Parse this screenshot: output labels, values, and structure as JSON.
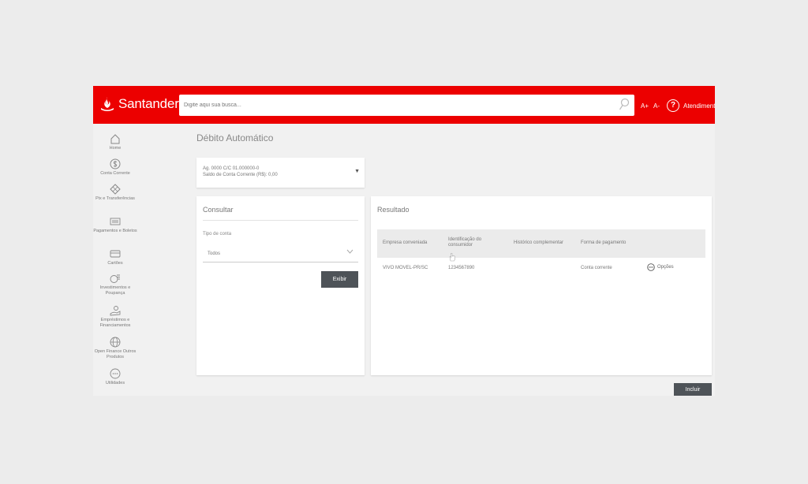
{
  "header": {
    "brand": "Santander",
    "search_placeholder": "Digite aqui sua busca...",
    "font_increase": "A+",
    "font_decrease": "A-",
    "help_label": "Atendimento"
  },
  "sidebar": {
    "items": [
      {
        "label": "Home",
        "icon": "home-icon"
      },
      {
        "label": "Conta Corrente",
        "icon": "dollar-icon"
      },
      {
        "label": "Pix e Transferências",
        "icon": "pix-icon"
      },
      {
        "label": "Pagamentos e Boletos",
        "icon": "barcode-icon"
      },
      {
        "label": "Cartões",
        "icon": "card-icon"
      },
      {
        "label": "Investimentos e Poupança",
        "icon": "investment-icon"
      },
      {
        "label": "Empréstimos e Financiamentos",
        "icon": "loan-icon"
      },
      {
        "label": "Open Finance Outros Produtos",
        "icon": "globe-icon"
      },
      {
        "label": "Utilidades",
        "icon": "more-icon"
      }
    ]
  },
  "main": {
    "title": "Débito Automático",
    "account": {
      "line1": "Ag. 0000 C/C 01.000000-0",
      "line2": "Saldo de Conta Corrente (R$): 0,00"
    },
    "consultar": {
      "title": "Consultar",
      "conta_label": "Tipo de conta",
      "select_value": "Todos",
      "button": "Exibir"
    },
    "resultado": {
      "title": "Resultado",
      "columns": [
        "Empresa conveniada",
        "Identificação do consumidor",
        "Histórico complementar",
        "Forma de pagamento"
      ],
      "rows": [
        {
          "empresa": "VIVO MOVEL-PR/SC",
          "identificacao": "1234567890",
          "historico": "",
          "forma": "Conta corrente",
          "acao": "Opções"
        }
      ]
    },
    "incluir_button": "Incluir"
  },
  "colors": {
    "brand_red": "#ec0000",
    "button_dark": "#4e5358"
  }
}
